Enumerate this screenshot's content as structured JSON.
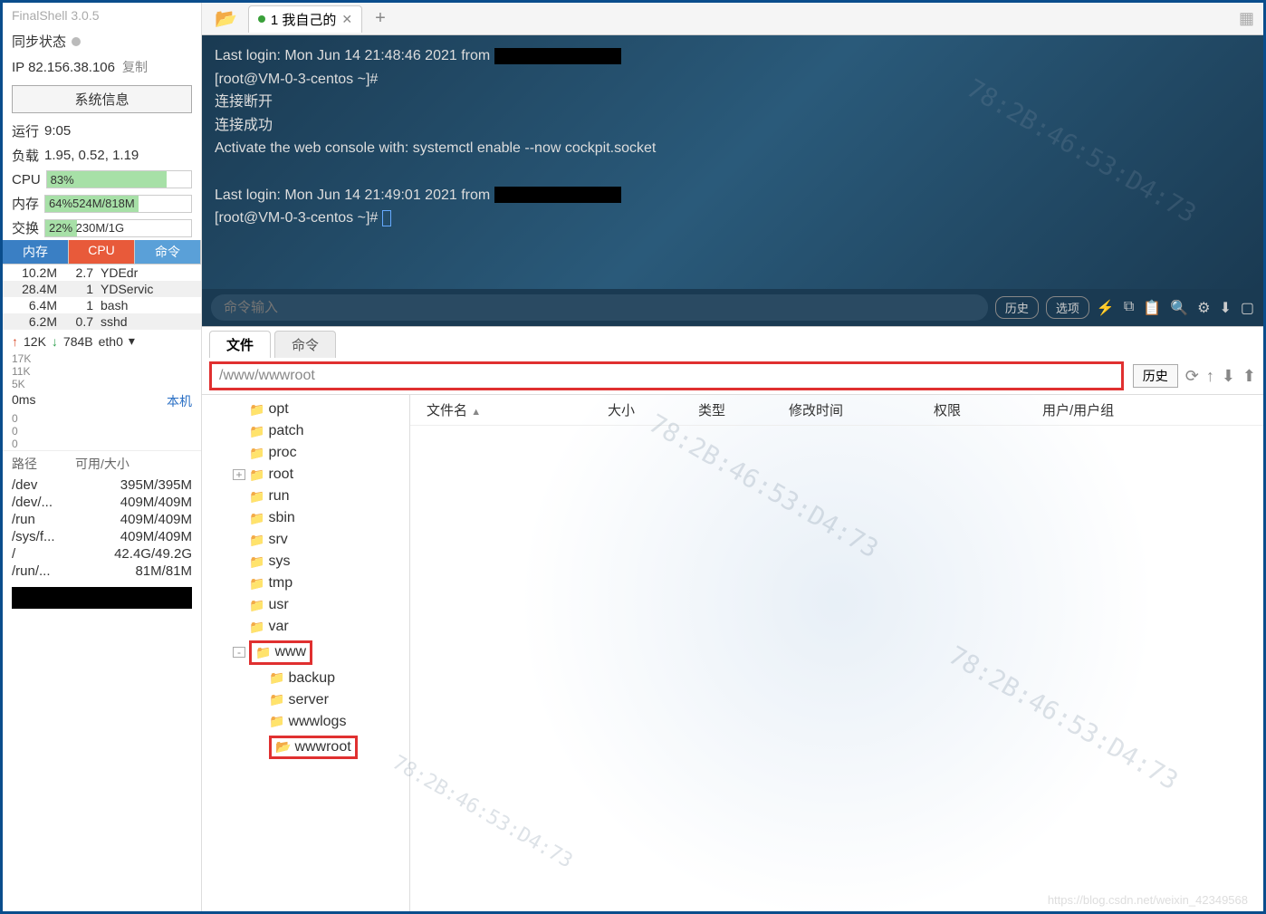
{
  "sidebar": {
    "app_hint": "FinalShell 3.0.5",
    "sync_label": "同步状态",
    "ip": "IP 82.156.38.106",
    "copy": "复制",
    "sysinfo_btn": "系统信息",
    "runtime_label": "运行",
    "runtime_val": "9:05",
    "load_label": "负载",
    "load_val": "1.95, 0.52, 1.19",
    "cpu_label": "CPU",
    "cpu_val": "83%",
    "mem_label": "内存",
    "mem_val": "64%524M/818M",
    "swap_label": "交换",
    "swap_val": "22%   230M/1G",
    "proc_tabs": {
      "mem": "内存",
      "cpu": "CPU",
      "cmd": "命令"
    },
    "processes": [
      {
        "mem": "10.2M",
        "cpu": "2.7",
        "cmd": "YDEdr"
      },
      {
        "mem": "28.4M",
        "cpu": "1",
        "cmd": "YDServic"
      },
      {
        "mem": "6.4M",
        "cpu": "1",
        "cmd": "bash"
      },
      {
        "mem": "6.2M",
        "cpu": "0.7",
        "cmd": "sshd"
      }
    ],
    "net_up": "12K",
    "net_down": "784B",
    "net_if": "eth0",
    "chart_y": [
      "17K",
      "11K",
      "5K"
    ],
    "ping_label": "0ms",
    "ping_host": "本机",
    "ping_vals": [
      "0",
      "0",
      "0"
    ],
    "disk_header": {
      "path": "路径",
      "size": "可用/大小"
    },
    "disks": [
      {
        "path": "/dev",
        "size": "395M/395M"
      },
      {
        "path": "/dev/...",
        "size": "409M/409M"
      },
      {
        "path": "/run",
        "size": "409M/409M"
      },
      {
        "path": "/sys/f...",
        "size": "409M/409M"
      },
      {
        "path": "/",
        "size": "42.4G/49.2G"
      },
      {
        "path": "/run/...",
        "size": "81M/81M"
      }
    ]
  },
  "tabbar": {
    "tab_label": "1 我自己的"
  },
  "terminal": {
    "l1": "Last login: Mon Jun 14 21:48:46 2021 from",
    "l2": "[root@VM-0-3-centos ~]#",
    "l3": "连接断开",
    "l4": "连接成功",
    "l5": "Activate the web console with: systemctl enable --now cockpit.socket",
    "l6": "Last login: Mon Jun 14 21:49:01 2021 from",
    "l7": "[root@VM-0-3-centos ~]# "
  },
  "cmdbar": {
    "placeholder": "命令输入",
    "history": "历史",
    "options": "选项"
  },
  "filearea": {
    "tab_file": "文件",
    "tab_cmd": "命令",
    "path": "/www/wwwroot",
    "history_btn": "历史",
    "tree": [
      {
        "indent": 1,
        "exp": "",
        "name": "opt",
        "hl": false
      },
      {
        "indent": 1,
        "exp": "",
        "name": "patch",
        "hl": false
      },
      {
        "indent": 1,
        "exp": "",
        "name": "proc",
        "hl": false
      },
      {
        "indent": 1,
        "exp": "+",
        "name": "root",
        "hl": false
      },
      {
        "indent": 1,
        "exp": "",
        "name": "run",
        "hl": false
      },
      {
        "indent": 1,
        "exp": "",
        "name": "sbin",
        "hl": false
      },
      {
        "indent": 1,
        "exp": "",
        "name": "srv",
        "hl": false
      },
      {
        "indent": 1,
        "exp": "",
        "name": "sys",
        "hl": false
      },
      {
        "indent": 1,
        "exp": "",
        "name": "tmp",
        "hl": false
      },
      {
        "indent": 1,
        "exp": "",
        "name": "usr",
        "hl": false
      },
      {
        "indent": 1,
        "exp": "",
        "name": "var",
        "hl": false
      },
      {
        "indent": 1,
        "exp": "-",
        "name": "www",
        "hl": true
      },
      {
        "indent": 2,
        "exp": "",
        "name": "backup",
        "hl": false
      },
      {
        "indent": 2,
        "exp": "",
        "name": "server",
        "hl": false
      },
      {
        "indent": 2,
        "exp": "",
        "name": "wwwlogs",
        "hl": false
      },
      {
        "indent": 2,
        "exp": "",
        "name": "wwwroot",
        "hl": true,
        "open": true
      }
    ],
    "list_header": {
      "name": "文件名",
      "size": "大小",
      "type": "类型",
      "modified": "修改时间",
      "perm": "权限",
      "user": "用户/用户组"
    }
  },
  "watermark": "78:2B:46:53:D4:73",
  "csdn": "https://blog.csdn.net/weixin_42349568"
}
